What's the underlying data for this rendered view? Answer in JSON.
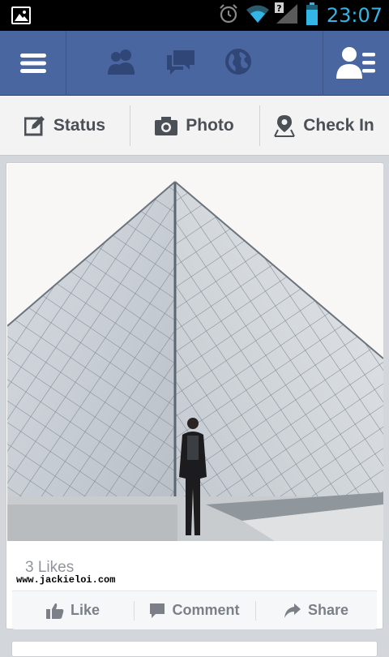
{
  "status_bar": {
    "time": "23:07",
    "icons": [
      "image-notification-icon",
      "alarm-icon",
      "wifi-icon",
      "signal-icon",
      "battery-icon"
    ],
    "accent": "#33b5e5"
  },
  "navbar": {
    "color": "#4a66a0",
    "icons": [
      "menu-icon",
      "friend-requests-icon",
      "messages-icon",
      "notifications-globe-icon",
      "friends-list-icon"
    ]
  },
  "composer": {
    "status_label": "Status",
    "photo_label": "Photo",
    "checkin_label": "Check In"
  },
  "post": {
    "likes": "3 Likes",
    "watermark": "www.jackieloi.com",
    "like_label": "Like",
    "comment_label": "Comment",
    "share_label": "Share"
  }
}
